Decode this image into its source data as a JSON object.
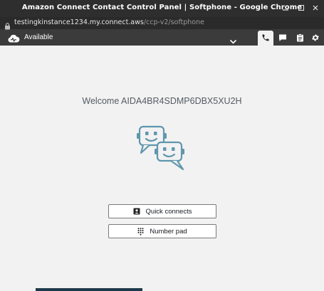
{
  "window": {
    "title": "Amazon Connect Contact Control Panel | Softphone - Google Chrome",
    "controls": [
      "minimize",
      "maximize",
      "close"
    ]
  },
  "address_bar": {
    "host": "testingkinstance1234.my.connect.aws",
    "path": "/ccp-v2/softphone"
  },
  "ccp_header": {
    "status_label": "Available",
    "tabs": [
      {
        "icon": "phone-icon",
        "active": true
      },
      {
        "icon": "chat-icon",
        "active": false
      },
      {
        "icon": "clipboard-icon",
        "active": false
      },
      {
        "icon": "gear-icon",
        "active": false
      }
    ]
  },
  "main": {
    "welcome_text": "Welcome AIDA4BR4SDMP6DBX5XU2H",
    "quick_connects_label": "Quick connects",
    "number_pad_label": "Number pad"
  },
  "colors": {
    "titlebar": "#2e2e2e",
    "ccp_header": "#3b3b3b",
    "background": "#f2f2f2",
    "illustration": "#5f97ad"
  }
}
